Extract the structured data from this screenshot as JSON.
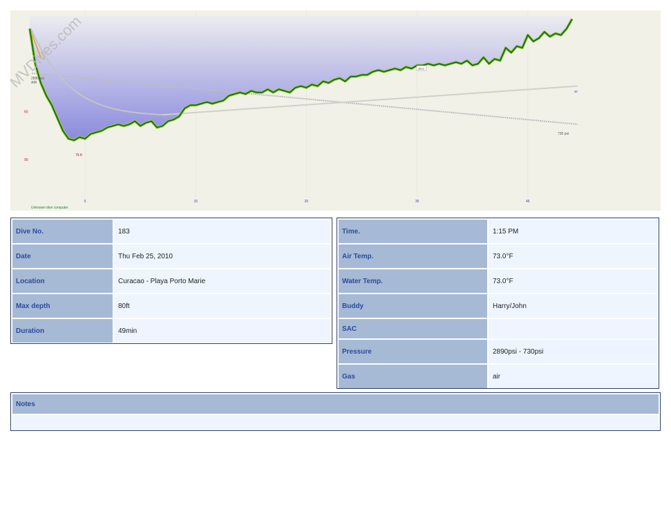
{
  "watermark": "MVDives.com",
  "chart_data": {
    "type": "area",
    "x_ticks": [
      5,
      15,
      25,
      35,
      45
    ],
    "y_ticks": [
      60,
      90
    ],
    "xlim": [
      0,
      57
    ],
    "ylim": [
      0,
      110
    ],
    "footer_label": "Unknown dive computer",
    "depth": {
      "x": [
        0,
        0.5,
        1,
        1.5,
        2,
        2.5,
        3,
        3.5,
        4,
        4.5,
        5,
        5.5,
        6,
        6.5,
        7,
        7.5,
        8,
        8.5,
        9,
        9.5,
        10,
        10.5,
        11,
        11.5,
        12,
        12.5,
        13,
        13.5,
        14,
        14.5,
        15,
        15.5,
        16,
        16.5,
        17,
        17.5,
        18,
        18.5,
        19,
        19.5,
        20,
        20.5,
        21,
        21.5,
        22,
        22.5,
        23,
        23.5,
        24,
        24.5,
        25,
        25.5,
        26,
        26.5,
        27,
        27.5,
        28,
        28.5,
        29,
        29.5,
        30,
        30.5,
        31,
        31.5,
        32,
        32.5,
        33,
        33.5,
        34,
        34.5,
        35,
        35.5,
        36,
        36.5,
        37,
        37.5,
        38,
        38.5,
        39,
        39.5,
        40,
        40.5,
        41,
        41.5,
        42,
        42.5,
        43,
        43.5,
        44,
        44.5,
        45,
        45.5,
        46,
        46.5,
        47,
        47.5,
        48,
        48.5,
        49
      ],
      "y": [
        8,
        30,
        42,
        50,
        56,
        64,
        72,
        77,
        78,
        76,
        77,
        74,
        73,
        72,
        70,
        69,
        68,
        69,
        68,
        66,
        69,
        67,
        66,
        70,
        69,
        66,
        65,
        63,
        58,
        56,
        56,
        55,
        54,
        55,
        54,
        53,
        50,
        49,
        48,
        49,
        47,
        48,
        48,
        46,
        48,
        46,
        47,
        48,
        45,
        44,
        45,
        43,
        44,
        41,
        42,
        40,
        39,
        41,
        38,
        38,
        37,
        37,
        35,
        34,
        35,
        34,
        33,
        34,
        32,
        33,
        31,
        31,
        30,
        31,
        30,
        31,
        30,
        29,
        30,
        28,
        31,
        30,
        26,
        30,
        27,
        28,
        20,
        23,
        19,
        20,
        12,
        16,
        14,
        10,
        13,
        11,
        12,
        8,
        2
      ]
    },
    "max_depth_label": "79.8",
    "start_pressure_label": "2890 psi",
    "end_pressure_label": "730 psi",
    "gas_label": "AIR",
    "top_label": "air",
    "waypoint_label": "30.5",
    "colors": {
      "area_top": "#e6e6ec",
      "area_bottom": "#8e8ee0",
      "line_dark": "#1e6b1e",
      "line_light": "#9ed43a",
      "bg": "#f2f1e8"
    }
  },
  "left_table": [
    {
      "label": "Dive No.",
      "value": "183"
    },
    {
      "label": "Date",
      "value": "Thu Feb 25, 2010"
    },
    {
      "label": "Location",
      "value": "Curacao - Playa Porto Marie"
    },
    {
      "label": "Max depth",
      "value": "80ft"
    },
    {
      "label": "Duration",
      "value": "49min"
    }
  ],
  "right_table": [
    {
      "label": "Time.",
      "value": "1:15 PM"
    },
    {
      "label": "Air Temp.",
      "value": "73.0°F"
    },
    {
      "label": "Water Temp.",
      "value": "73.0°F"
    },
    {
      "label": "Buddy",
      "value": "Harry/John"
    },
    {
      "label": "SAC",
      "value": ""
    },
    {
      "label": "Pressure",
      "value": "2890psi - 730psi"
    },
    {
      "label": "Gas",
      "value": "air"
    }
  ],
  "notes": {
    "label": "Notes",
    "value": ""
  }
}
